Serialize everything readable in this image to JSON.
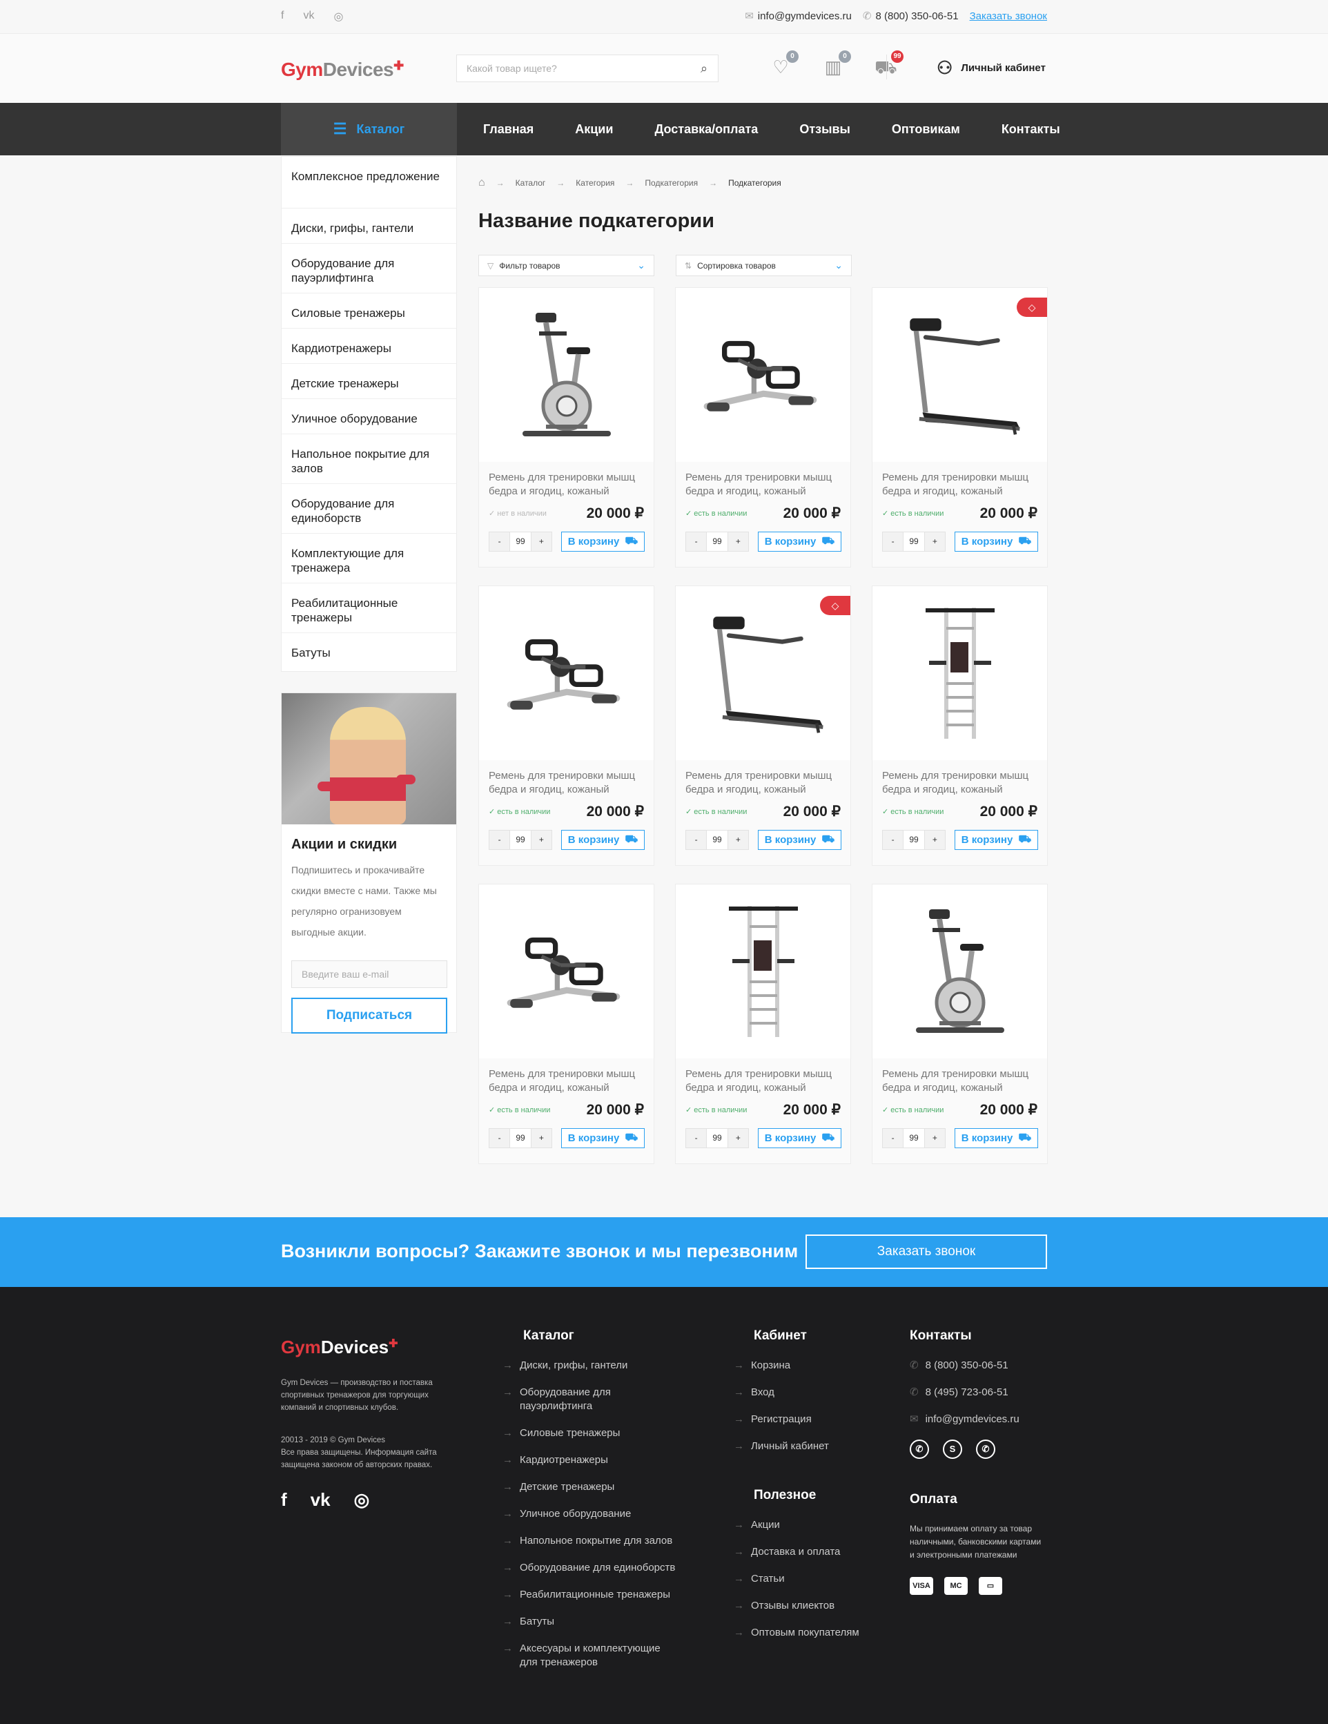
{
  "topbar": {
    "social": [
      "f",
      "vk",
      "◎"
    ],
    "email": "info@gymdevices.ru",
    "phone": "8 (800) 350-06-51",
    "callback_link": "Заказать звонок"
  },
  "header": {
    "logo_a": "Gym",
    "logo_b": "Devices",
    "search_placeholder": "Какой товар ищете?",
    "favorites_count": "0",
    "compare_count": "0",
    "cart_count": "99",
    "account_label": "Личный кабинет"
  },
  "nav": {
    "catalog_label": "Каталог",
    "items": [
      "Главная",
      "Акции",
      "Доставка/оплата",
      "Отзывы",
      "Оптовикам",
      "Контакты"
    ]
  },
  "sidebar": {
    "items": [
      "Комплексное предложение",
      "Диски, грифы, гантели",
      "Оборудование для пауэрлифтинга",
      "Силовые тренажеры",
      "Кардиотренажеры",
      "Детские тренажеры",
      "Уличное оборудование",
      "Напольное покрытие для залов",
      "Оборудование для единоборств",
      "Комплектующие для тренажера",
      "Реабилитационные тренажеры",
      "Батуты"
    ]
  },
  "promo": {
    "title": "Акции и скидки",
    "text": "Подпишитесь и прокачивайте скидки вместе с нами. Также мы регулярно огранизовуем выгодные акции.",
    "email_placeholder": "Введите ваш e-mail",
    "button": "Подписаться"
  },
  "breadcrumb": [
    "Каталог",
    "Категория",
    "Подкатегория",
    "Подкатегория"
  ],
  "page_title": "Название подкатегории",
  "filter_label": "Фильтр товаров",
  "sort_label": "Сортировка товаров",
  "products": [
    {
      "name": "Ремень для тренировки мышц бедра и ягодиц, кожаный",
      "stock": "нет в наличии",
      "in_stock": false,
      "price": "20 000 ₽",
      "qty": "99",
      "cart_label": "В корзину",
      "image": "exercise-bike",
      "hit": false
    },
    {
      "name": "Ремень для тренировки мышц бедра и ягодиц, кожаный",
      "stock": "есть в наличии",
      "in_stock": true,
      "price": "20 000 ₽",
      "qty": "99",
      "cart_label": "В корзину",
      "image": "pedal-exerciser",
      "hit": false
    },
    {
      "name": "Ремень для тренировки мышц бедра и ягодиц, кожаный",
      "stock": "есть в наличии",
      "in_stock": true,
      "price": "20 000 ₽",
      "qty": "99",
      "cart_label": "В корзину",
      "image": "treadmill",
      "hit": true
    },
    {
      "name": "Ремень для тренировки мышц бедра и ягодиц, кожаный",
      "stock": "есть в наличии",
      "in_stock": true,
      "price": "20 000 ₽",
      "qty": "99",
      "cart_label": "В корзину",
      "image": "pedal-exerciser",
      "hit": false
    },
    {
      "name": "Ремень для тренировки мышц бедра и ягодиц, кожаный",
      "stock": "есть в наличии",
      "in_stock": true,
      "price": "20 000 ₽",
      "qty": "99",
      "cart_label": "В корзину",
      "image": "treadmill",
      "hit": true
    },
    {
      "name": "Ремень для тренировки мышц бедра и ягодиц, кожаный",
      "stock": "есть в наличии",
      "in_stock": true,
      "price": "20 000 ₽",
      "qty": "99",
      "cart_label": "В корзину",
      "image": "wall-bars",
      "hit": false
    },
    {
      "name": "Ремень для тренировки мышц бедра и ягодиц, кожаный",
      "stock": "есть в наличии",
      "in_stock": true,
      "price": "20 000 ₽",
      "qty": "99",
      "cart_label": "В корзину",
      "image": "pedal-exerciser",
      "hit": false
    },
    {
      "name": "Ремень для тренировки мышц бедра и ягодиц, кожаный",
      "stock": "есть в наличии",
      "in_stock": true,
      "price": "20 000 ₽",
      "qty": "99",
      "cart_label": "В корзину",
      "image": "wall-bars",
      "hit": false
    },
    {
      "name": "Ремень для тренировки мышц бедра и ягодиц, кожаный",
      "stock": "есть в наличии",
      "in_stock": true,
      "price": "20 000 ₽",
      "qty": "99",
      "cart_label": "В корзину",
      "image": "exercise-bike",
      "hit": false
    }
  ],
  "callback": {
    "title": "Возникли вопросы? Закажите звонок и мы перезвоним",
    "button": "Заказать звонок"
  },
  "footer": {
    "logo_a": "Gym",
    "logo_b": "Devices",
    "about": "Gym Devices — производство и поставка спортивных тренажеров для торгующих компаний и спортивных клубов.",
    "copyright": "20013 - 2019 © Gym Devices",
    "rights": "Все права защищены. Информация сайта защищена законом об авторских правах.",
    "social": [
      "f",
      "vk",
      "◎"
    ],
    "catalog_title": "Каталог",
    "catalog_links": [
      "Диски, грифы, гантели",
      "Оборудование для пауэрлифтинга",
      "Силовые тренажеры",
      "Кардиотренажеры",
      "Детские тренажеры",
      "Уличное оборудование",
      "Напольное покрытие для залов",
      "Оборудование для единоборств",
      "Реабилитационные тренажеры",
      "Батуты",
      "Аксесуары и комплектующие для тренажеров"
    ],
    "cabinet_title": "Кабинет",
    "cabinet_links": [
      "Корзина",
      "Вход",
      "Регистрация",
      "Личный кабинет"
    ],
    "useful_title": "Полезное",
    "useful_links": [
      "Акции",
      "Доставка и оплата",
      "Статьи",
      "Отзывы клиектов",
      "Оптовым покупателям"
    ],
    "contacts_title": "Контакты",
    "phone1": "8 (800) 350-06-51",
    "phone2": "8 (495) 723-06-51",
    "email": "info@gymdevices.ru",
    "payment_title": "Оплата",
    "payment_text": "Мы принимаем оплату за товар наличными, банковскими картами и электронными платежами",
    "payment_cards": [
      "VISA",
      "MC",
      "▭"
    ]
  },
  "colors": {
    "accent": "#2aa0f0",
    "brand_red": "#e0383f",
    "nav_bg": "#343434",
    "footer_bg": "#1c1c1e",
    "stock_green": "#4fae6c"
  }
}
